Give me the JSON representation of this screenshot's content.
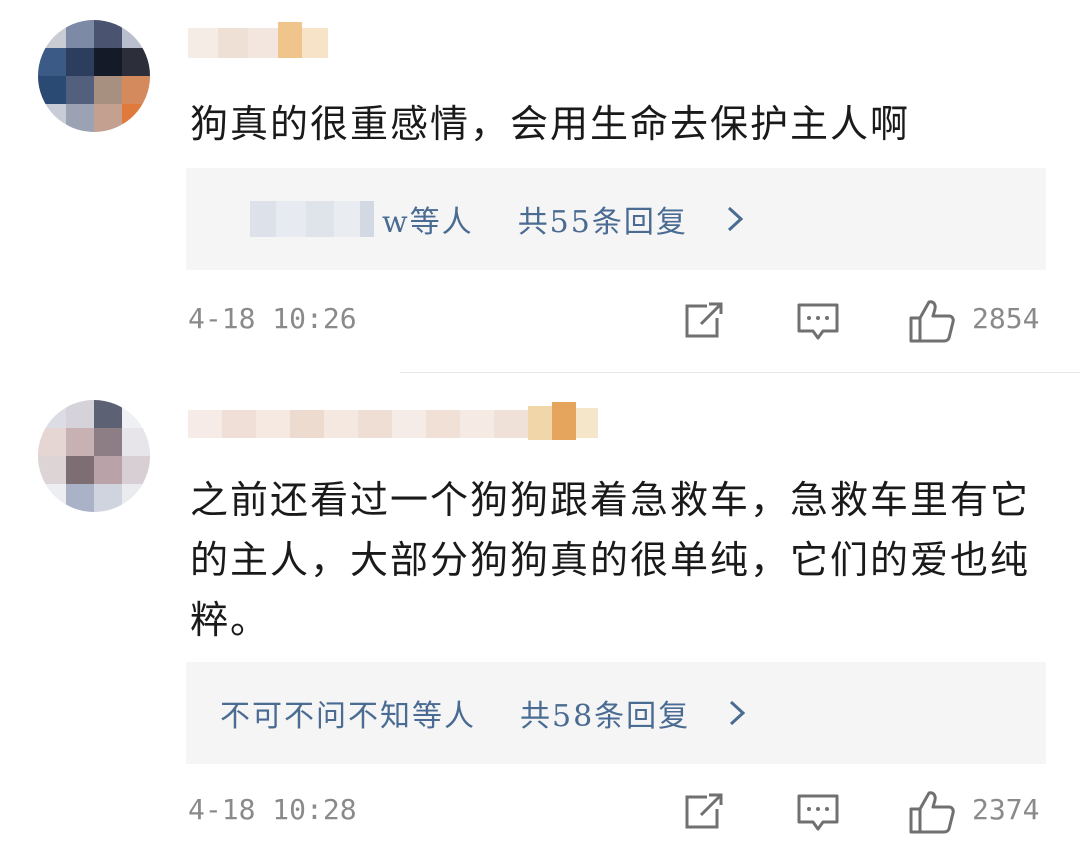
{
  "comments": [
    {
      "text": "狗真的很重感情，会用生命去保护主人啊",
      "replies": {
        "repliers_suffix": "w等人",
        "total": "共55条回复"
      },
      "time": "4-18 10:26",
      "likes": "2854"
    },
    {
      "text": "之前还看过一个狗狗跟着急救车，急救车里有它的主人，大部分狗狗真的很单纯，它们的爱也纯粹。",
      "replies": {
        "repliers": "不可不问不知等人",
        "total": "共58条回复"
      },
      "time": "4-18 10:28",
      "likes": "2374"
    }
  ],
  "icons": {
    "avatar": "avatar-image",
    "share": "share-icon",
    "comment": "comment-icon",
    "like": "thumbs-up-icon",
    "chevron": "chevron-right-icon"
  },
  "colors": {
    "link": "#4a6b92",
    "meta": "#8a8a8a",
    "reply_bg": "#f5f5f5"
  }
}
